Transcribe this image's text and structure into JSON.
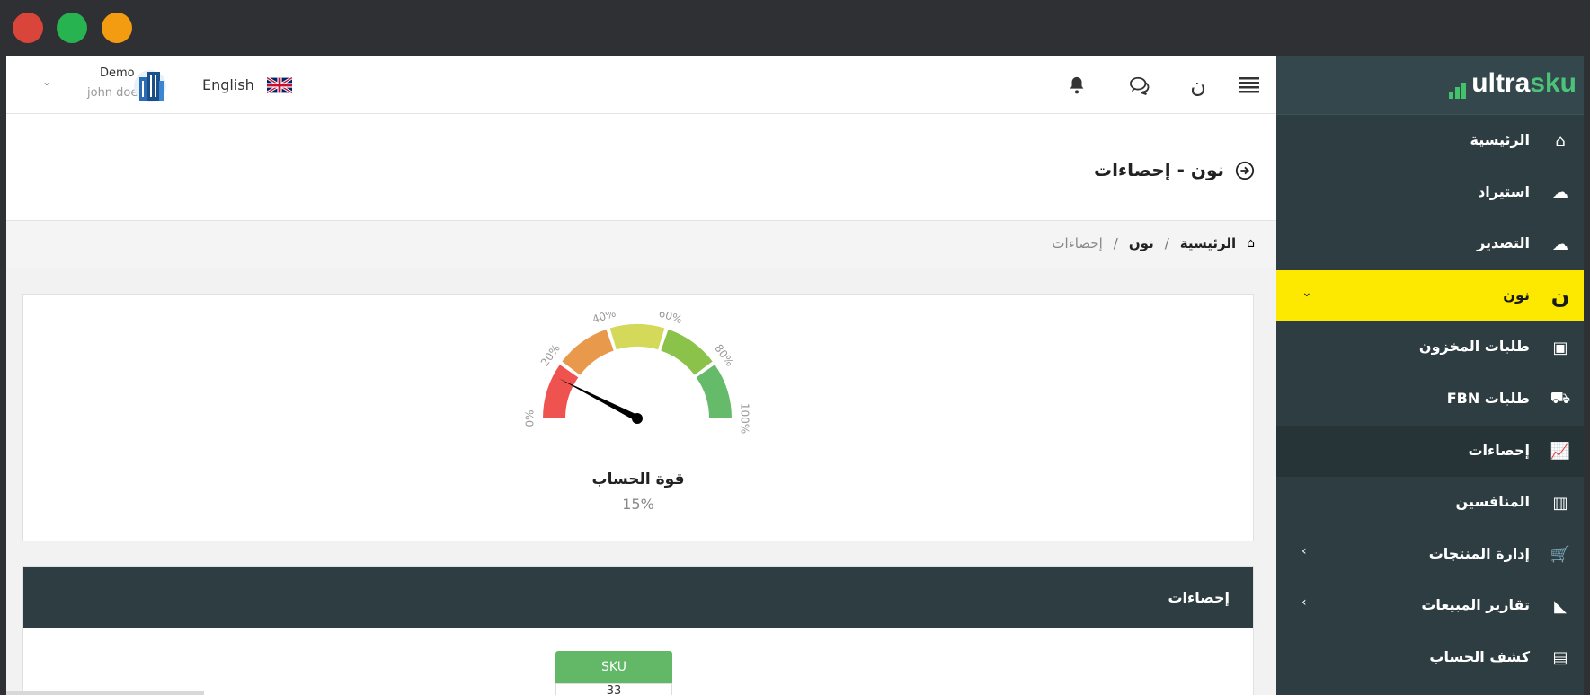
{
  "window_controls": {
    "close_color": "#d9453a",
    "minimize_color": "#27b34f",
    "maximize_color": "#f39c12"
  },
  "brand": {
    "part1": "ultra",
    "part2": "sku"
  },
  "sidebar": {
    "items": [
      {
        "label": "الرئيسية",
        "icon": "home-icon"
      },
      {
        "label": "استيراد",
        "icon": "cloud-upload-icon"
      },
      {
        "label": "التصدير",
        "icon": "cloud-download-icon"
      },
      {
        "label": "نون",
        "icon": "noon-icon",
        "active": true,
        "chevron": "⌄"
      },
      {
        "label": "طلبات المخزون",
        "icon": "boxes-icon"
      },
      {
        "label": "طلبات FBN",
        "icon": "truck-icon"
      },
      {
        "label": "إحصاءات",
        "icon": "chart-line-icon",
        "current": true
      },
      {
        "label": "المنافسين",
        "icon": "bar-chart-icon"
      },
      {
        "label": "إدارة المنتجات",
        "icon": "cart-icon",
        "chevron": "‹"
      },
      {
        "label": "تقارير المبيعات",
        "icon": "area-chart-icon",
        "chevron": "‹"
      },
      {
        "label": "كشف الحساب",
        "icon": "money-icon"
      }
    ],
    "active_color": "#fde900"
  },
  "topbar": {
    "language": "English",
    "user_name": "Demo",
    "user_sub": "john doe"
  },
  "page": {
    "title": "نون - إحصاءات",
    "breadcrumb": {
      "home": "الرئيسية",
      "sep": "/",
      "section": "نون",
      "current": "إحصاءات"
    }
  },
  "gauge": {
    "label": "قوة الحساب",
    "value_text": "15%",
    "value": 15,
    "ticks": [
      "0%",
      "20%",
      "40%",
      "60%",
      "80%",
      "100%"
    ],
    "colors": [
      "#ef5350",
      "#e8994c",
      "#d4d95a",
      "#8bc34a",
      "#66bb6a"
    ]
  },
  "stats": {
    "title": "إحصاءات",
    "columns": [
      "SKU"
    ],
    "first_cell": "33"
  }
}
